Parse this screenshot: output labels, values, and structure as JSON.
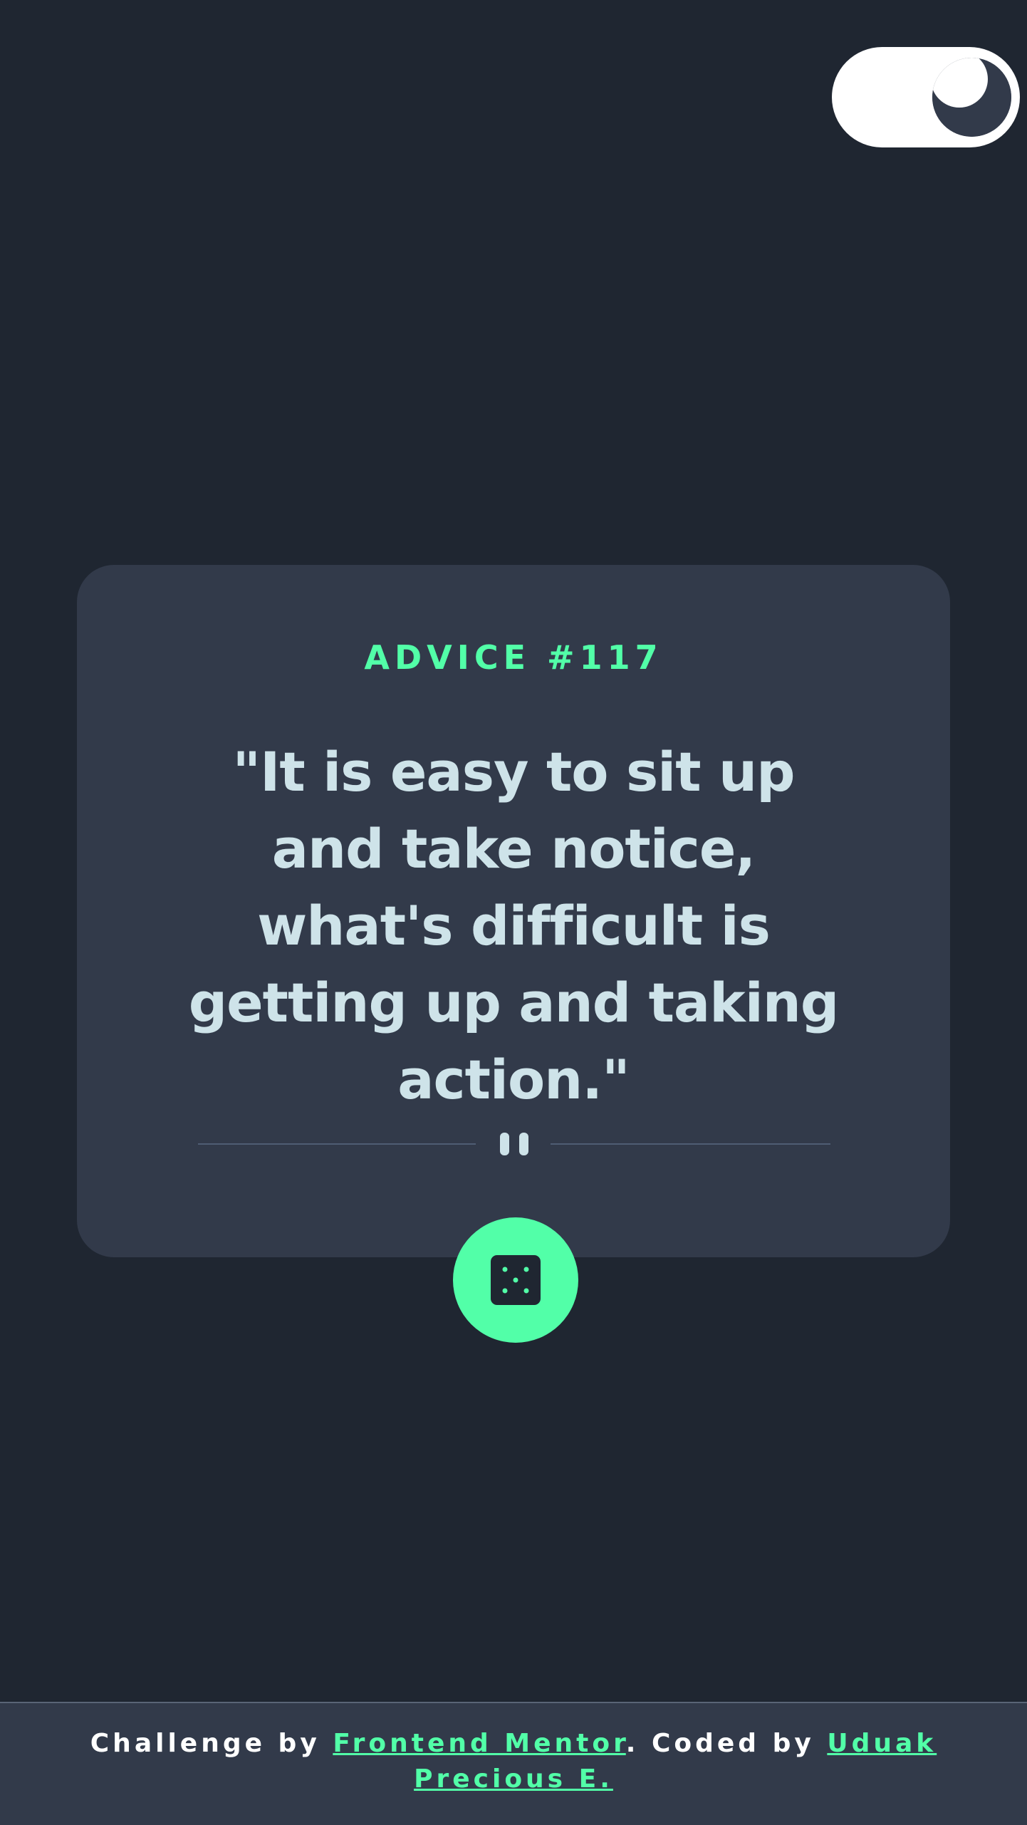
{
  "theme_toggle": {
    "icon": "moon-icon",
    "state": "dark"
  },
  "advice": {
    "id_label": "ADVICE #117",
    "text": "\"It is easy to sit up and take notice, what's difficult is getting up and taking action.\""
  },
  "divider": {
    "icon": "pause-icon"
  },
  "generate_button": {
    "icon": "dice-icon"
  },
  "footer": {
    "prefix": "Challenge by ",
    "challenge_link": "Frontend Mentor",
    "middle": ". Coded by ",
    "author_link": "Uduak Precious E."
  },
  "colors": {
    "background": "#1f2631",
    "card": "#323a4a",
    "accent": "#52ffa8",
    "text": "#cee3e9"
  }
}
